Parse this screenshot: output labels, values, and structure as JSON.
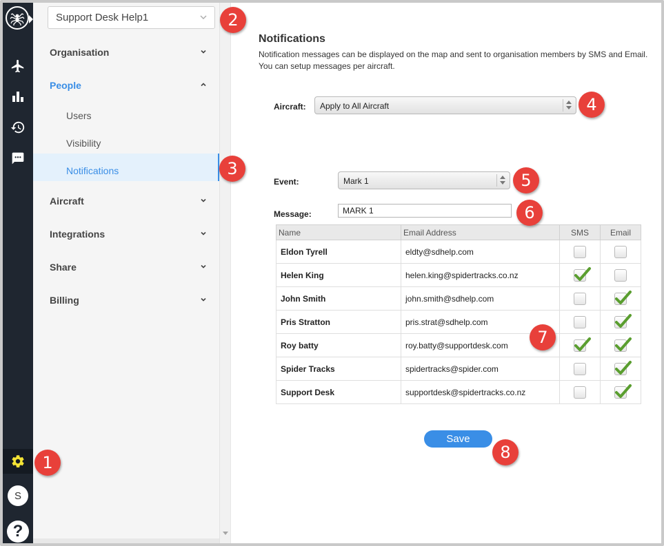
{
  "sidebar_rail": {
    "icons": [
      "spider-logo-icon",
      "airplane-icon",
      "bar-chart-icon",
      "history-icon",
      "chat-icon",
      "gear-icon"
    ],
    "avatar_initial": "S",
    "help_label": "?",
    "active_color": "#f3e335",
    "rail_color": "#1f2630"
  },
  "settings_nav": {
    "org_selector": "Support Desk Help1",
    "sections": [
      {
        "label": "Organisation"
      },
      {
        "label": "People"
      },
      {
        "label": "Aircraft"
      },
      {
        "label": "Integrations"
      },
      {
        "label": "Share"
      },
      {
        "label": "Billing"
      }
    ],
    "people_items": [
      "Users",
      "Visibility",
      "Notifications"
    ],
    "accent_color": "#3a8ee6"
  },
  "main": {
    "title": "Notifications",
    "description": "Notification messages can be displayed on the map and sent to organisation members by SMS and Email. You can setup messages per aircraft.",
    "aircraft_label": "Aircraft:",
    "aircraft_value": "Apply to All Aircraft",
    "event_label": "Event:",
    "event_value": "Mark 1",
    "message_label": "Message:",
    "message_value": "MARK 1",
    "table": {
      "headers": [
        "Name",
        "Email Address",
        "SMS",
        "Email"
      ],
      "rows": [
        {
          "name": "Eldon Tyrell",
          "email": "eldty@sdhelp.com",
          "sms": false,
          "email_on": false
        },
        {
          "name": "Helen King",
          "email": "helen.king@spidertracks.co.nz",
          "sms": true,
          "email_on": false
        },
        {
          "name": "John Smith",
          "email": "john.smith@sdhelp.com",
          "sms": false,
          "email_on": true
        },
        {
          "name": "Pris Stratton",
          "email": "pris.strat@sdhelp.com",
          "sms": false,
          "email_on": true
        },
        {
          "name": "Roy batty",
          "email": "roy.batty@supportdesk.com",
          "sms": true,
          "email_on": true
        },
        {
          "name": "Spider Tracks",
          "email": "spidertracks@spider.com",
          "sms": false,
          "email_on": true
        },
        {
          "name": "Support Desk",
          "email": "supportdesk@spidertracks.co.nz",
          "sms": false,
          "email_on": true
        }
      ]
    },
    "save_label": "Save"
  },
  "callouts": [
    "1",
    "2",
    "3",
    "4",
    "5",
    "6",
    "7",
    "8"
  ],
  "callout_color": "#e8403a"
}
